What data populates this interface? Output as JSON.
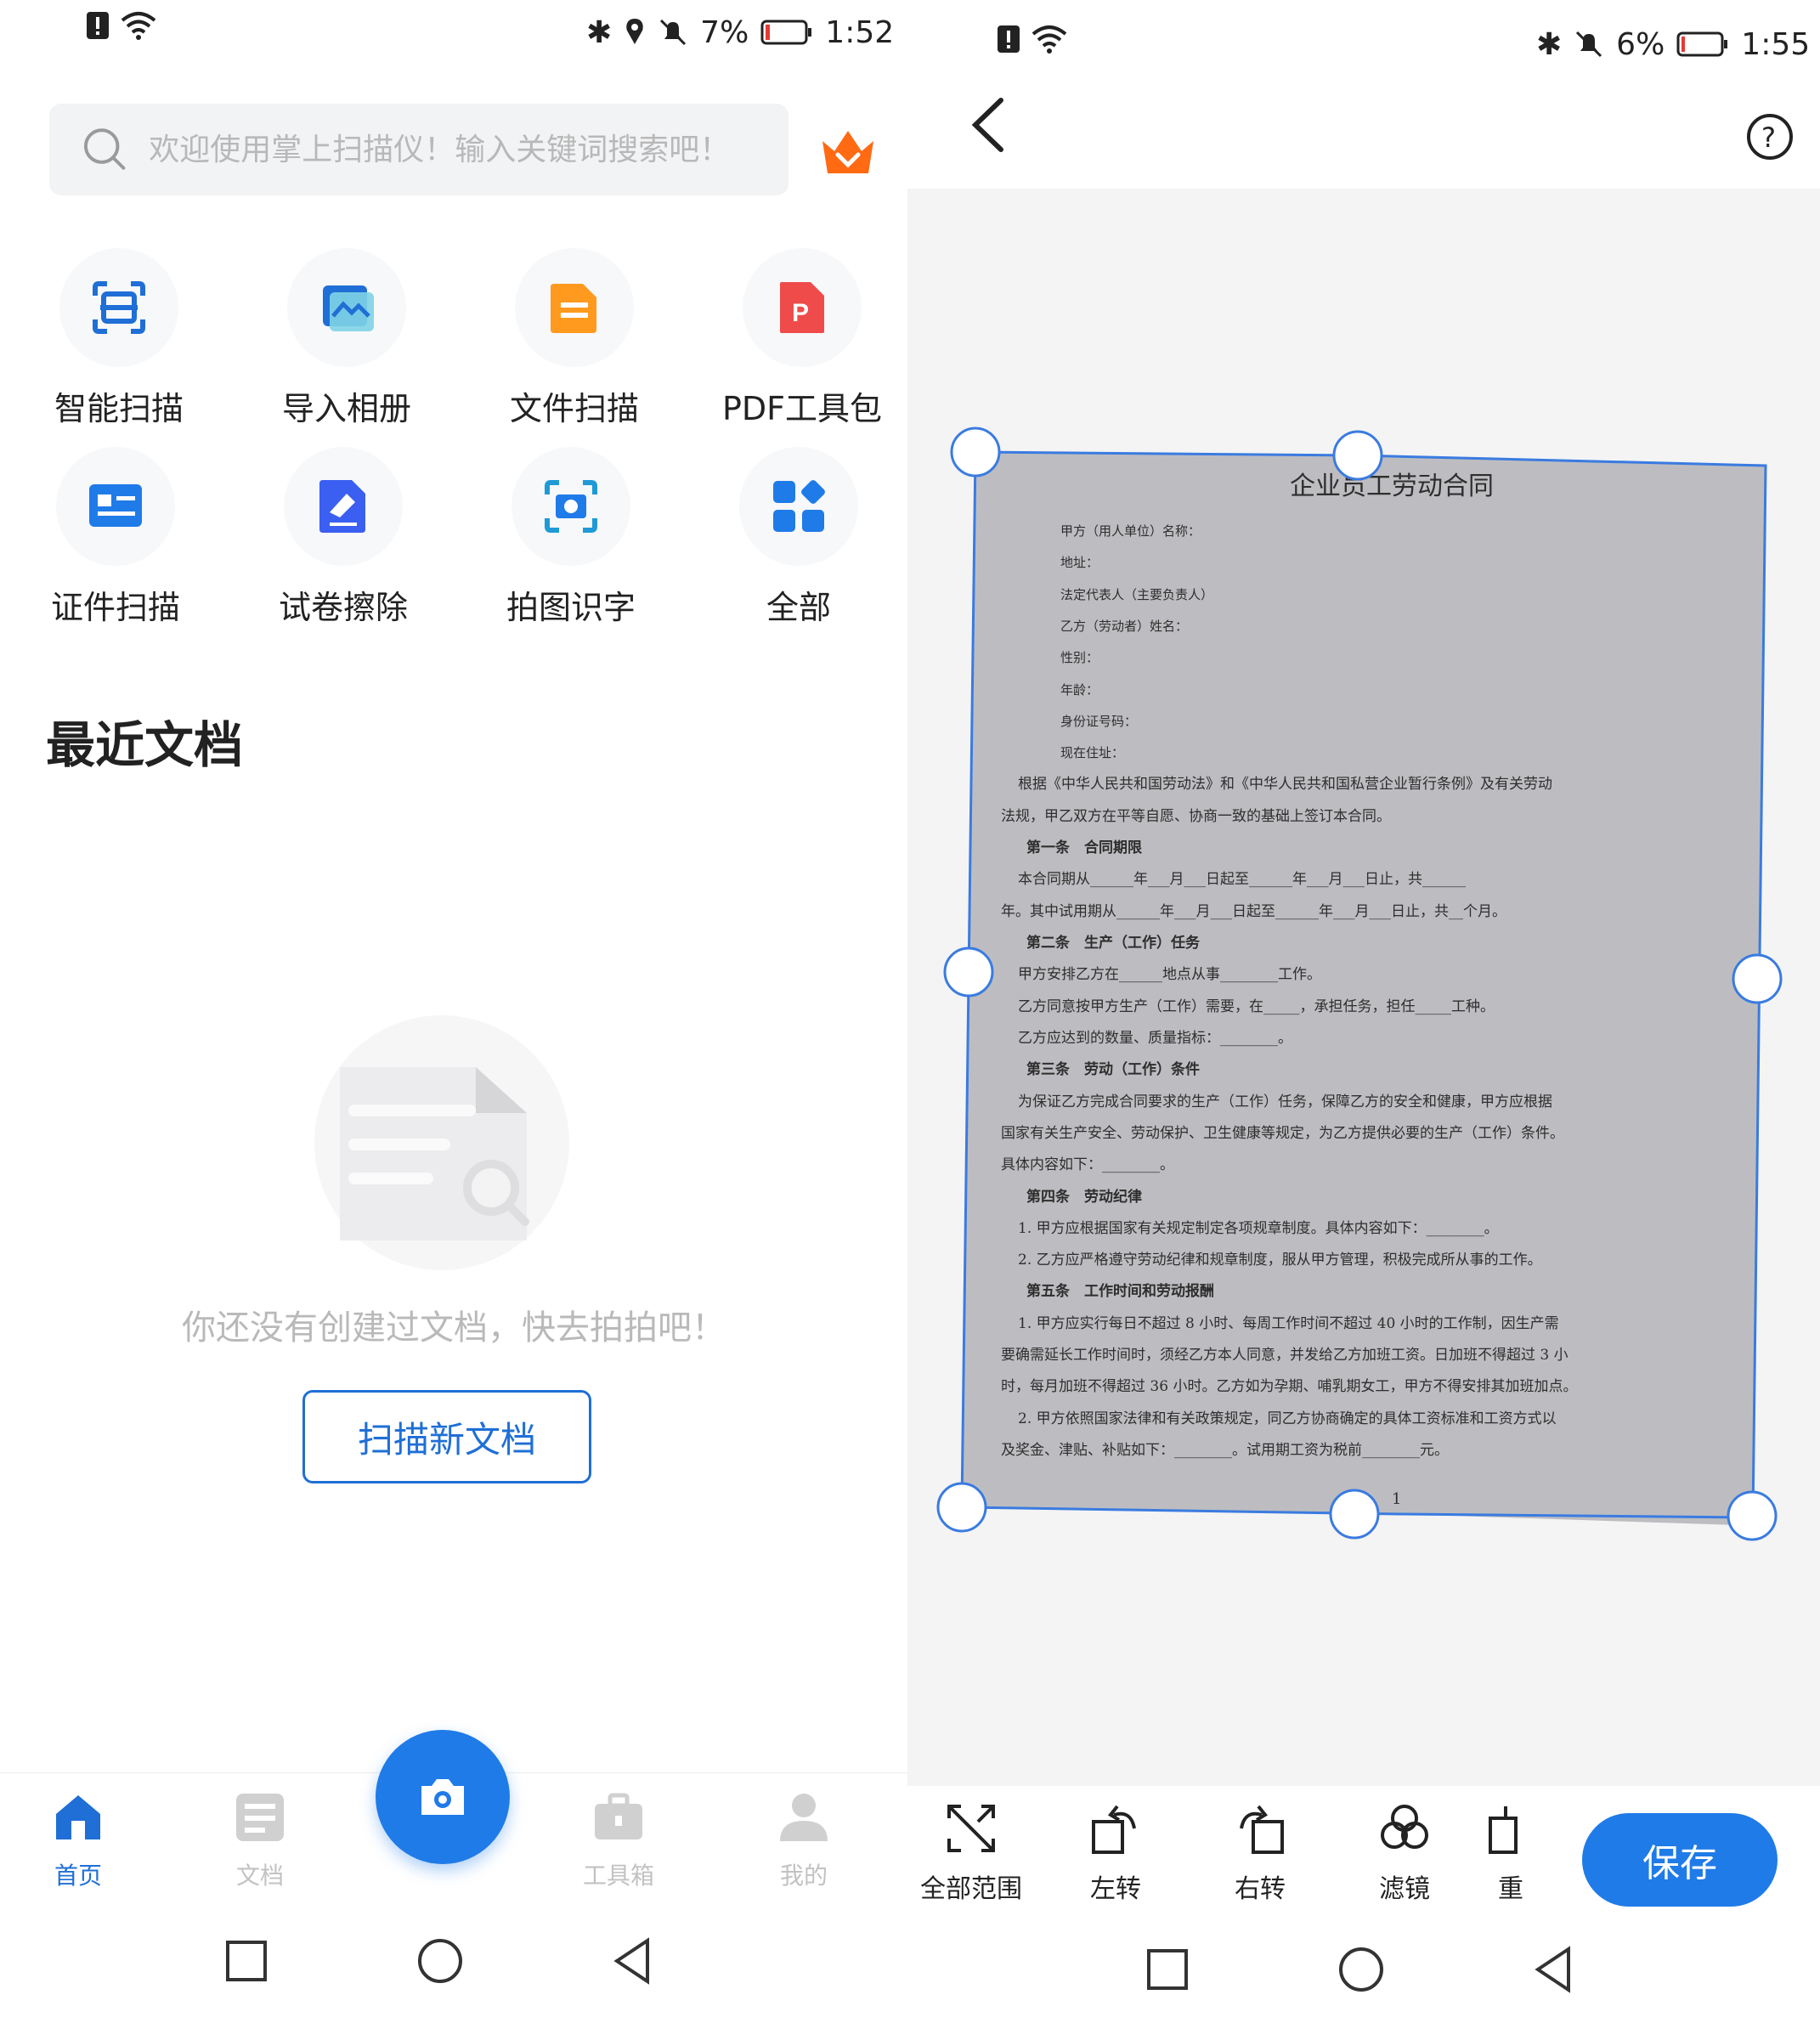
{
  "left": {
    "status": {
      "battery": "7%",
      "time": "1:52"
    },
    "search": {
      "placeholder": "欢迎使用掌上扫描仪！输入关键词搜索吧！"
    },
    "tools": [
      {
        "label": "智能扫描",
        "icon": "smart-scan-icon"
      },
      {
        "label": "导入相册",
        "icon": "import-album-icon"
      },
      {
        "label": "文件扫描",
        "icon": "file-scan-icon"
      },
      {
        "label": "PDF工具包",
        "icon": "pdf-toolkit-icon"
      },
      {
        "label": "证件扫描",
        "icon": "id-scan-icon"
      },
      {
        "label": "试卷擦除",
        "icon": "paper-erase-icon"
      },
      {
        "label": "拍图识字",
        "icon": "photo-ocr-icon"
      },
      {
        "label": "全部",
        "icon": "all-apps-icon"
      }
    ],
    "recent_title": "最近文档",
    "empty_text": "你还没有创建过文档，快去拍拍吧！",
    "scan_new_label": "扫描新文档",
    "tabs": [
      {
        "label": "首页",
        "active": true
      },
      {
        "label": "文档",
        "active": false
      },
      {
        "label": "工具箱",
        "active": false
      },
      {
        "label": "我的",
        "active": false
      }
    ],
    "colors": {
      "accent": "#1f7be8",
      "vip": "#ff6a13"
    }
  },
  "right": {
    "status": {
      "battery": "6%",
      "time": "1:55"
    },
    "document": {
      "title": "企业员工劳动合同",
      "lines": [
        "甲方（用人单位）名称：",
        "地址：",
        "法定代表人（主要负责人）",
        "乙方（劳动者）姓名：",
        "性别：",
        "年龄：",
        "身份证号码：",
        "现在住址：",
        "根据《中华人民共和国劳动法》和《中华人民共和国私营企业暂行条例》及有关劳动",
        "法规，甲乙双方在平等自愿、协商一致的基础上签订本合同。",
        "第一条　合同期限",
        "本合同期从______年___月___日起至______年___月___日止，共______",
        "年。其中试用期从______年___月___日起至______年___月___日止，共__个月。",
        "第二条　生产（工作）任务",
        "甲方安排乙方在______地点从事________工作。",
        "乙方同意按甲方生产（工作）需要，在_____，承担任务，担任_____工种。",
        "乙方应达到的数量、质量指标：________。",
        "第三条　劳动（工作）条件",
        "为保证乙方完成合同要求的生产（工作）任务，保障乙方的安全和健康，甲方应根据",
        "国家有关生产安全、劳动保护、卫生健康等规定，为乙方提供必要的生产（工作）条件。",
        "具体内容如下：________。",
        "第四条　劳动纪律",
        "1. 甲方应根据国家有关规定制定各项规章制度。具体内容如下：________。",
        "2. 乙方应严格遵守劳动纪律和规章制度，服从甲方管理，积极完成所从事的工作。",
        "第五条　工作时间和劳动报酬",
        "1. 甲方应实行每日不超过 8 小时、每周工作时间不超过 40 小时的工作制，因生产需",
        "要确需延长工作时间时，须经乙方本人同意，并发给乙方加班工资。日加班不得超过 3 小",
        "时，每月加班不得超过 36 小时。乙方如为孕期、哺乳期女工，甲方不得安排其加班加点。",
        "2. 甲方依照国家法律和有关政策规定，同乙方协商确定的具体工资标准和工资方式以",
        "及奖金、津贴、补贴如下：________。试用期工资为税前________元。"
      ],
      "page_number": "1"
    },
    "tools": [
      {
        "label": "全部范围",
        "icon": "full-range-icon"
      },
      {
        "label": "左转",
        "icon": "rotate-left-icon"
      },
      {
        "label": "右转",
        "icon": "rotate-right-icon"
      },
      {
        "label": "滤镜",
        "icon": "filter-icon"
      },
      {
        "label": "重",
        "icon": "redo-icon"
      }
    ],
    "save_label": "保存"
  }
}
